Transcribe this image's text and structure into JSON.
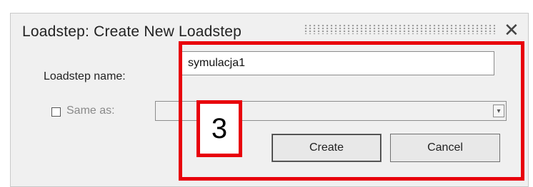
{
  "dialog": {
    "title": "Loadstep: Create New Loadstep",
    "close_label": "✕"
  },
  "form": {
    "name_label": "Loadstep name:",
    "name_value": "symulacja1",
    "same_as_label": "Same as:",
    "same_as_checked": false,
    "same_as_value": ""
  },
  "buttons": {
    "create_label": "Create",
    "cancel_label": "Cancel"
  },
  "annotation": {
    "step_number": "3",
    "color": "#e8000b"
  }
}
